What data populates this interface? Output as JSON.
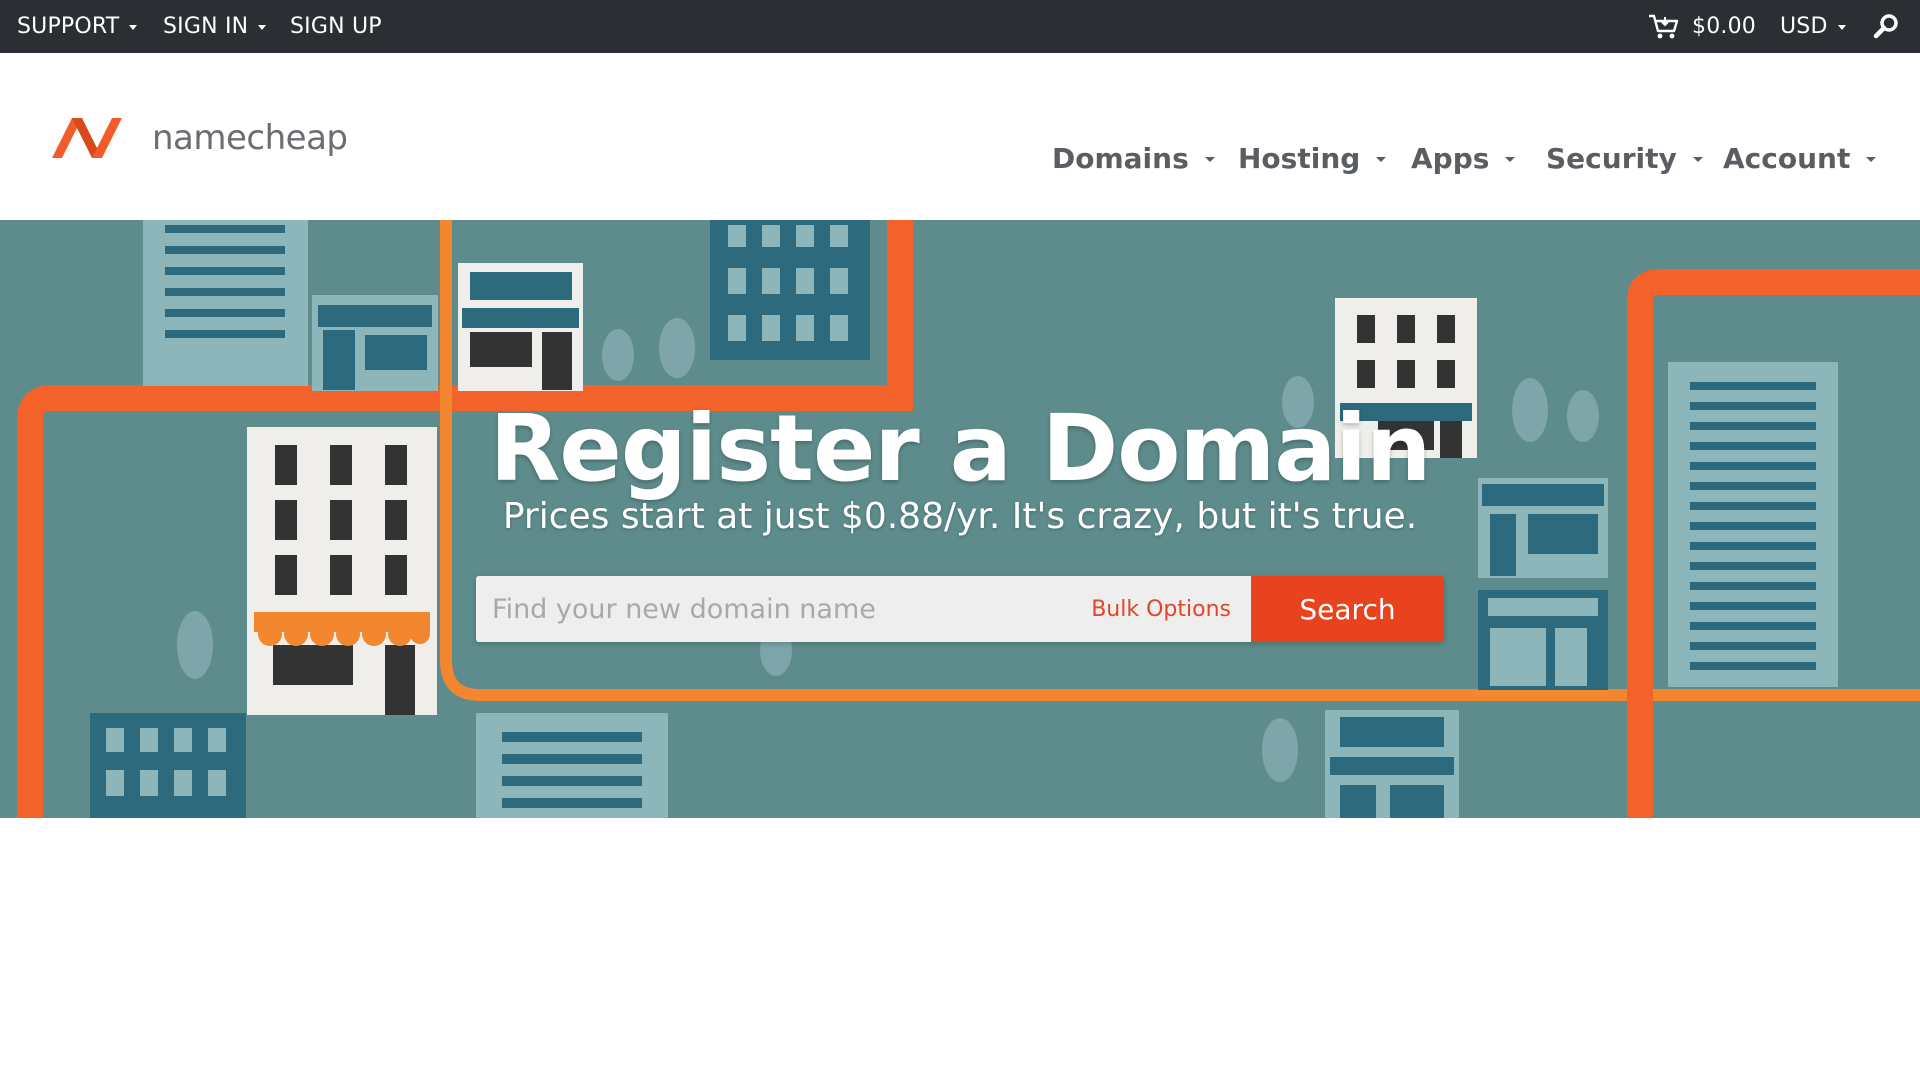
{
  "topbar": {
    "support": "SUPPORT",
    "sign_in": "SIGN IN",
    "sign_up": "SIGN UP",
    "cart_total": "$0.00",
    "currency": "USD"
  },
  "brand": {
    "logo_text": "namecheap",
    "accent_color": "#f25c2a"
  },
  "nav": {
    "items": [
      {
        "label": "Domains"
      },
      {
        "label": "Hosting"
      },
      {
        "label": "Apps"
      },
      {
        "label": "Security"
      },
      {
        "label": "Account"
      }
    ]
  },
  "hero": {
    "title": "Register a Domain",
    "subtitle": "Prices start at just $0.88/yr. It's crazy, but it's true.",
    "search_placeholder": "Find your new domain name",
    "bulk_options": "Bulk Options",
    "search_button": "Search",
    "background_color": "#5e8c8c",
    "button_color": "#e8431e"
  }
}
